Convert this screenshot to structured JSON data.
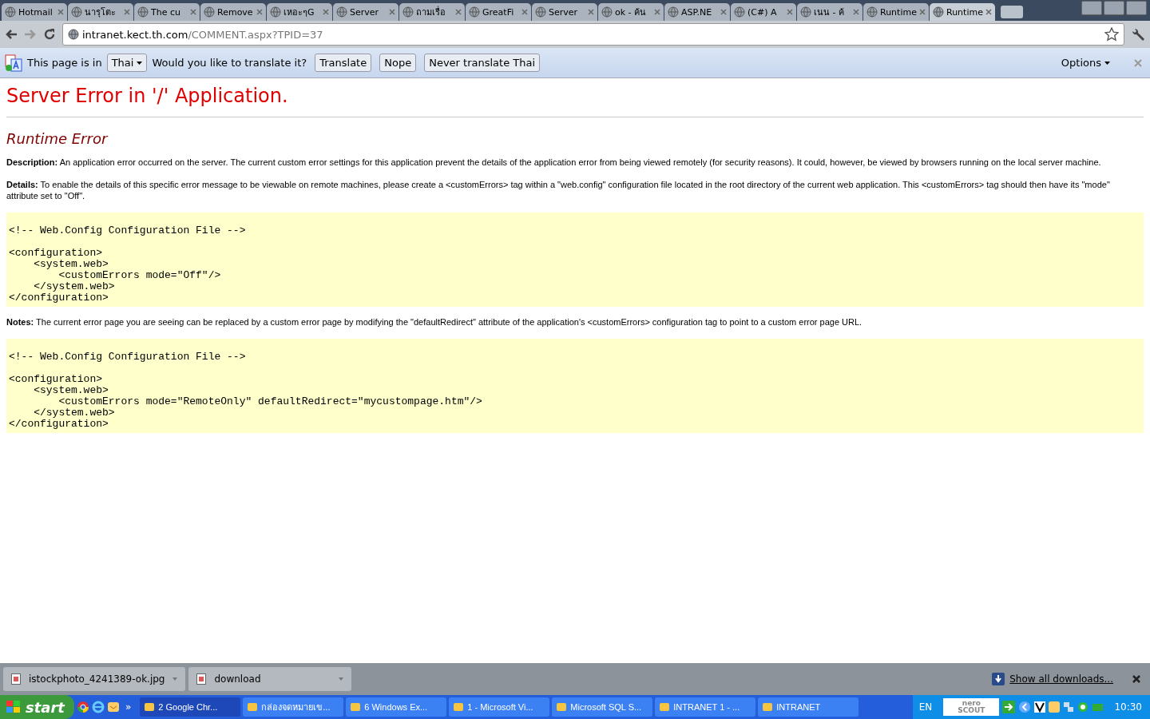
{
  "tabs": [
    {
      "label": "Hotmail",
      "selected": false
    },
    {
      "label": "นารุโตะ",
      "selected": false
    },
    {
      "label": "The cu",
      "selected": false
    },
    {
      "label": "Remove",
      "selected": false
    },
    {
      "label": "เหอะๆG",
      "selected": false
    },
    {
      "label": "Server",
      "selected": false
    },
    {
      "label": "ถามเรื่อ",
      "selected": false
    },
    {
      "label": "GreatFi",
      "selected": false
    },
    {
      "label": "Server",
      "selected": false
    },
    {
      "label": "ok - ค้น",
      "selected": false
    },
    {
      "label": "ASP.NE",
      "selected": false
    },
    {
      "label": "(C#) A",
      "selected": false
    },
    {
      "label": "เนน - ค้",
      "selected": false
    },
    {
      "label": "Runtime",
      "selected": false
    },
    {
      "label": "Runtime",
      "selected": true
    }
  ],
  "address": {
    "host": "intranet.kect.th.com",
    "path": "/COMMENT.aspx?TPID=37"
  },
  "translate_bar": {
    "lead": "This page is in",
    "language": "Thai",
    "question": "Would you like to translate it?",
    "buttons": [
      "Translate",
      "Nope",
      "Never translate Thai"
    ],
    "options": "Options"
  },
  "page": {
    "title": "Server Error in '/' Application.",
    "subtitle": "Runtime Error",
    "blocks": [
      {
        "kind": "para",
        "text": "**Description:** An application error occurred on the server. The current custom error settings for this application prevent the details of the application error from being viewed remotely (for security reasons). It could, however, be viewed by browsers running on the local server machine."
      },
      {
        "kind": "para",
        "text": "**Details:** To enable the details of this specific error message to be viewable on remote machines, please create a <customErrors> tag within a \"web.config\" configuration file located in the root directory of the current web application. This <customErrors> tag should then have its \"mode\" attribute set to \"Off\"."
      },
      {
        "kind": "code",
        "text": "<!-- Web.Config Configuration File -->\n\n<configuration>\n    <system.web>\n        <customErrors mode=\"Off\"/>\n    </system.web>\n</configuration>"
      },
      {
        "kind": "para",
        "text": "**Notes:** The current error page you are seeing can be replaced by a custom error page by modifying the \"defaultRedirect\" attribute of the application's <customErrors> configuration tag to point to a custom error page URL."
      },
      {
        "kind": "code",
        "text": "<!-- Web.Config Configuration File -->\n\n<configuration>\n    <system.web>\n        <customErrors mode=\"RemoteOnly\" defaultRedirect=\"mycustompage.htm\"/>\n    </system.web>\n</configuration>"
      }
    ]
  },
  "downloads": {
    "items": [
      "istockphoto_4241389-ok.jpg",
      "download"
    ],
    "show_all": "Show all downloads..."
  },
  "taskbar": {
    "start": "start",
    "overflow": "»",
    "tasks": [
      {
        "label": "2 Google Chr...",
        "selected": true
      },
      {
        "label": "กล่องจดหมายเข...",
        "selected": false
      },
      {
        "label": "6 Windows Ex...",
        "selected": false
      },
      {
        "label": "1 - Microsoft Vi...",
        "selected": false
      },
      {
        "label": "Microsoft SQL S...",
        "selected": false
      },
      {
        "label": "INTRANET 1 - ...",
        "selected": false
      },
      {
        "label": "INTRANET",
        "selected": false
      }
    ],
    "language": "EN",
    "nero": [
      "nero",
      "SCOUT"
    ],
    "clock": "10:30"
  }
}
